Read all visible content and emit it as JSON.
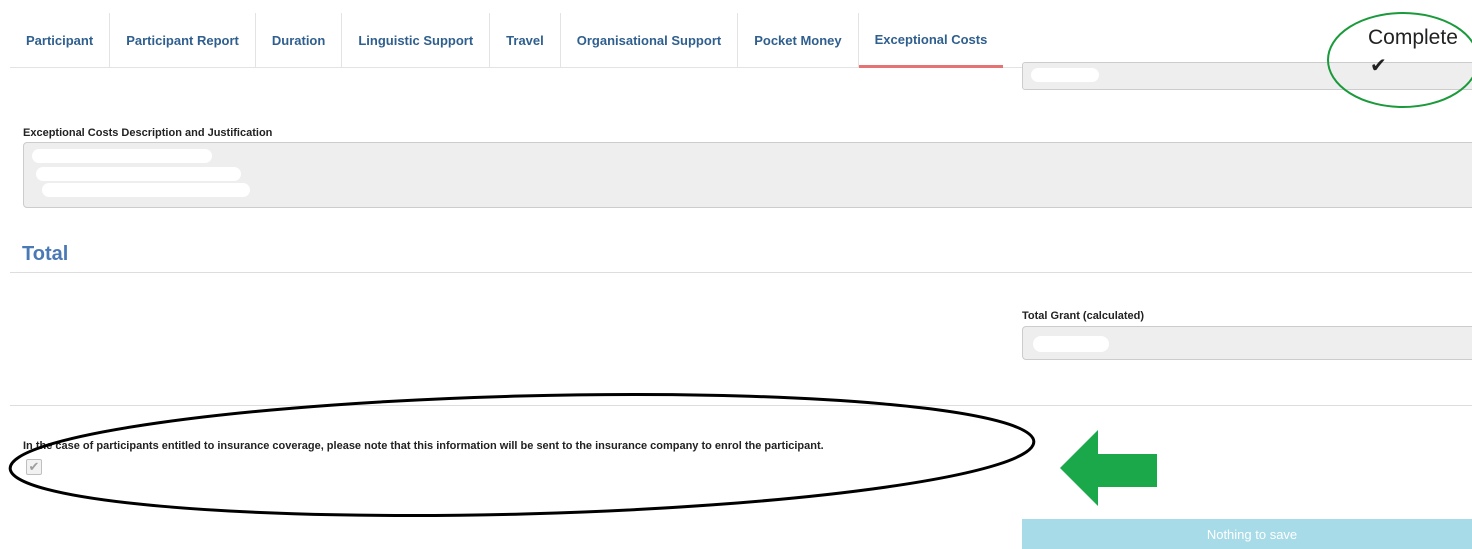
{
  "tabs": [
    {
      "label": "Participant"
    },
    {
      "label": "Participant Report"
    },
    {
      "label": "Duration"
    },
    {
      "label": "Linguistic Support"
    },
    {
      "label": "Travel"
    },
    {
      "label": "Organisational Support"
    },
    {
      "label": "Pocket Money"
    },
    {
      "label": "Exceptional Costs",
      "active": true
    }
  ],
  "status": {
    "label": "Complete",
    "icon": "checkmark-icon"
  },
  "description": {
    "label": "Exceptional Costs Description and Justification"
  },
  "total": {
    "title": "Total",
    "grant_label": "Total Grant (calculated)"
  },
  "insurance": {
    "notice": "In the case of participants entitled to insurance coverage, please note that this information will be sent to the insurance company to enrol the participant.",
    "checked": true
  },
  "actions": {
    "save_label": "Nothing to save"
  },
  "colors": {
    "tab_text": "#2f5f8e",
    "active_underline": "#e57373",
    "section_title": "#4a7ab5",
    "save_button": "#a7dbe8",
    "arrow": "#1aa84a"
  }
}
